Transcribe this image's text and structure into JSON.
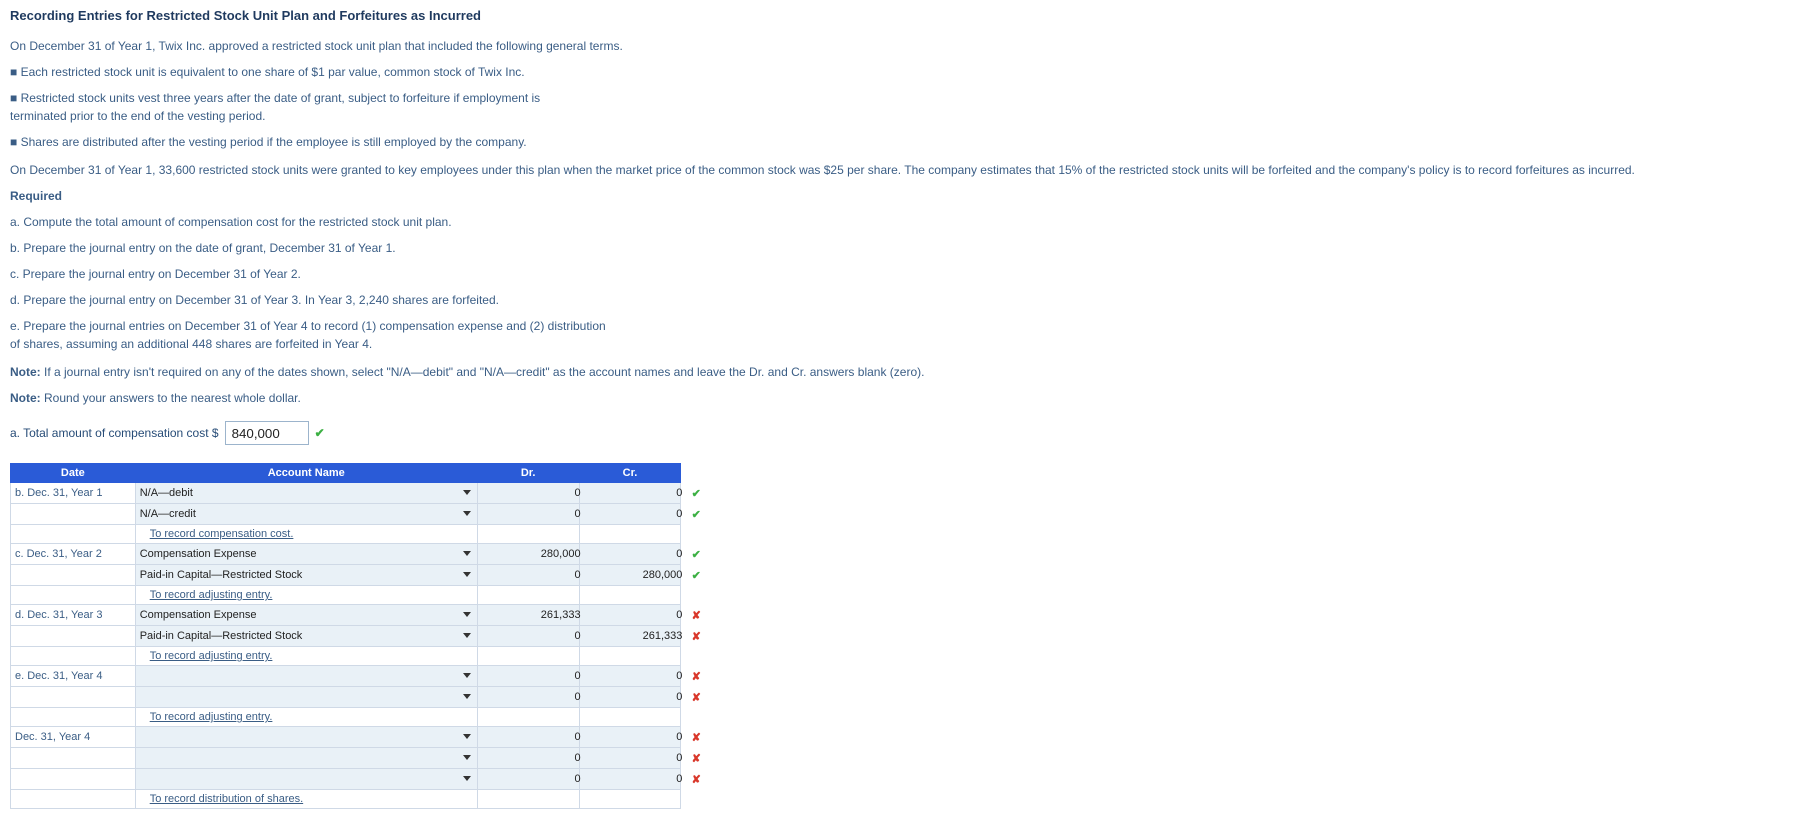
{
  "title": "Recording Entries for Restricted Stock Unit Plan and Forfeitures as Incurred",
  "intro1": "On December 31 of Year 1, Twix Inc. approved a restricted stock unit plan that included the following general terms.",
  "bullets": [
    "Each restricted stock unit is equivalent to one share of $1 par value, common stock of Twix Inc.",
    "Restricted stock units vest three years after the date of grant, subject to forfeiture if employment is",
    "terminated prior to the end of the vesting period.",
    "Shares are distributed after the vesting period if the employee is still employed by the company."
  ],
  "intro2": "On December 31 of Year 1, 33,600 restricted stock units were granted to key employees under this plan when the market price of the common stock was $25 per share. The company estimates that 15% of the restricted stock units will be forfeited and the company's policy is to record forfeitures as incurred.",
  "required_head": "Required",
  "required": [
    "a. Compute the total amount of compensation cost for the restricted stock unit plan.",
    "b. Prepare the journal entry on the date of grant, December 31 of Year 1.",
    "c. Prepare the journal entry on December 31 of Year 2.",
    "d. Prepare the journal entry on December 31 of Year 3. In Year 3, 2,240 shares are forfeited.",
    "e. Prepare the journal entries on December 31 of Year 4 to record (1) compensation expense and (2) distribution",
    "of shares, assuming an additional 448 shares are forfeited in Year 4."
  ],
  "note1_b": "Note:",
  "note1": " If a journal entry isn't required on any of the dates shown, select \"N/A—debit\" and \"N/A—credit\" as the account names and leave the Dr. and Cr. answers blank (zero).",
  "note2_b": "Note:",
  "note2": " Round your answers to the nearest whole dollar.",
  "partA": {
    "label": "a. Total amount of compensation cost $",
    "value": "840,000",
    "mark": "✔"
  },
  "headers": {
    "date": "Date",
    "acct": "Account Name",
    "dr": "Dr.",
    "cr": "Cr."
  },
  "rows": [
    {
      "date": "b. Dec. 31, Year 1",
      "acct": "N/A—debit",
      "sel": true,
      "dr": "0",
      "cr": "0",
      "mark": "✔",
      "ok": true
    },
    {
      "date": "",
      "acct": "N/A—credit",
      "sel": true,
      "dr": "0",
      "cr": "0",
      "mark": "✔",
      "ok": true
    },
    {
      "memo": "To record compensation cost."
    },
    {
      "date": "c. Dec. 31, Year 2",
      "acct": "Compensation Expense",
      "sel": true,
      "dr": "280,000",
      "cr": "0",
      "mark": "✔",
      "ok": true
    },
    {
      "date": "",
      "acct": "Paid-in Capital—Restricted Stock",
      "sel": true,
      "dr": "0",
      "cr": "280,000",
      "mark": "✔",
      "ok": true
    },
    {
      "memo": "To record adjusting entry."
    },
    {
      "date": "d. Dec. 31, Year 3",
      "acct": "Compensation Expense",
      "sel": true,
      "dr": "261,333",
      "cr": "0",
      "mark": "✘",
      "ok": false
    },
    {
      "date": "",
      "acct": "Paid-in Capital—Restricted Stock",
      "sel": true,
      "dr": "0",
      "cr": "261,333",
      "mark": "✘",
      "ok": false
    },
    {
      "memo": "To record adjusting entry."
    },
    {
      "date": "e. Dec. 31, Year 4",
      "acct": "",
      "sel": true,
      "dr": "0",
      "cr": "0",
      "mark": "✘",
      "ok": false
    },
    {
      "date": "",
      "acct": "",
      "sel": true,
      "dr": "0",
      "cr": "0",
      "mark": "✘",
      "ok": false
    },
    {
      "memo": "To record adjusting entry."
    },
    {
      "date": "Dec. 31, Year 4",
      "acct": "",
      "sel": true,
      "dr": "0",
      "cr": "0",
      "mark": "✘",
      "ok": false
    },
    {
      "date": "",
      "acct": "",
      "sel": true,
      "dr": "0",
      "cr": "0",
      "mark": "✘",
      "ok": false
    },
    {
      "date": "",
      "acct": "",
      "sel": true,
      "dr": "0",
      "cr": "0",
      "mark": "✘",
      "ok": false
    },
    {
      "memo": "To record distribution of shares."
    }
  ]
}
